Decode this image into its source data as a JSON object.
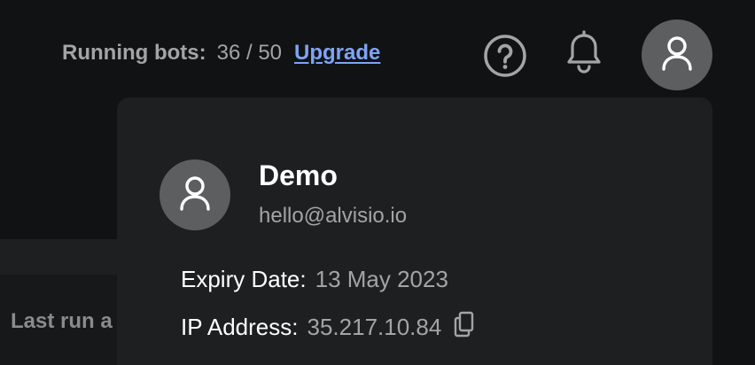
{
  "header": {
    "running_label": "Running bots:",
    "running_count": "36 / 50",
    "upgrade_label": "Upgrade",
    "icons": [
      "help-icon",
      "bell-icon",
      "user-icon"
    ]
  },
  "background": {
    "last_run_text": "Last run a"
  },
  "profile_menu": {
    "name": "Demo",
    "email": "hello@alvisio.io",
    "expiry_label": "Expiry Date:",
    "expiry_value": "13 May 2023",
    "ip_label": "IP Address:",
    "ip_value": "35.217.10.84",
    "copy_icon": "copy-icon"
  },
  "colors": {
    "background": "#111213",
    "panel": "#1e1f20",
    "avatar": "#5d5e60",
    "link": "#7ea4f7",
    "muted_text": "#a3a4a6",
    "primary_text": "#ffffff"
  }
}
